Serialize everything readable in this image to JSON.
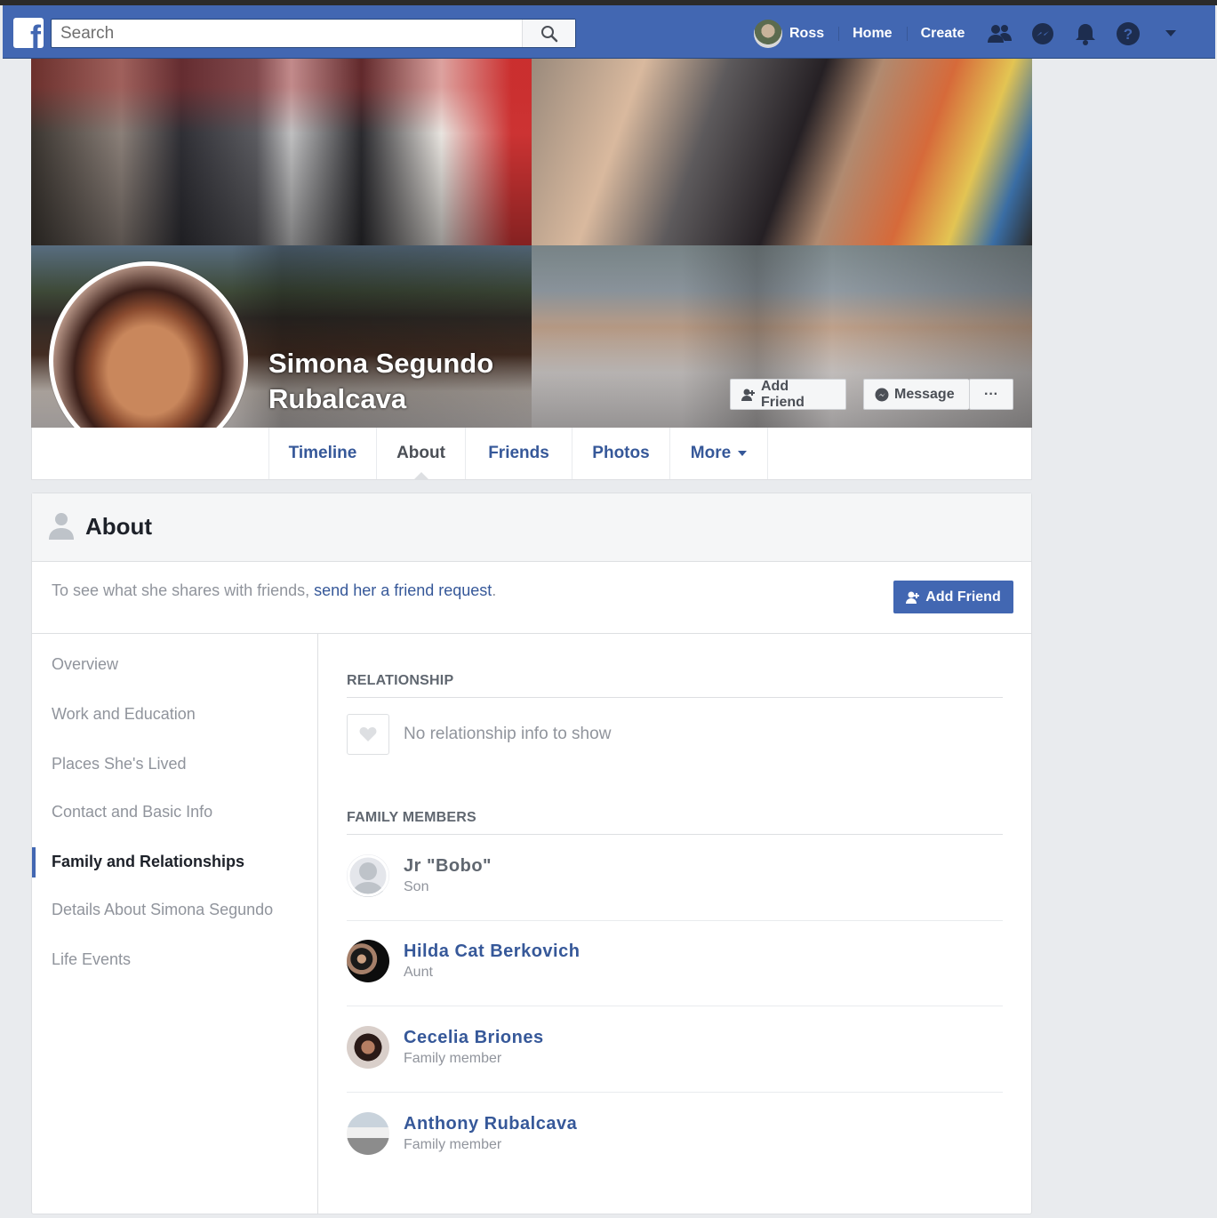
{
  "header": {
    "search_placeholder": "Search",
    "user_name": "Ross",
    "home_label": "Home",
    "create_label": "Create",
    "icons": [
      "friends-icon",
      "messenger-icon",
      "notifications-icon",
      "help-icon",
      "account-menu-icon"
    ]
  },
  "profile": {
    "name_line1": "Simona Segundo",
    "name_line2": "Rubalcava",
    "add_friend_label": "Add Friend",
    "message_label": "Message",
    "more_label": "···"
  },
  "tabs": [
    {
      "label": "Timeline"
    },
    {
      "label": "About"
    },
    {
      "label": "Friends"
    },
    {
      "label": "Photos"
    },
    {
      "label": "More"
    }
  ],
  "about": {
    "title": "About",
    "notice_prefix": "To see what she shares with friends, ",
    "notice_link": "send her a friend request",
    "notice_suffix": ".",
    "add_friend_label": "Add Friend",
    "nav": [
      {
        "label": "Overview"
      },
      {
        "label": "Work and Education"
      },
      {
        "label": "Places She's Lived"
      },
      {
        "label": "Contact and Basic Info"
      },
      {
        "label": "Family and Relationships"
      },
      {
        "label": "Details About Simona Segundo"
      },
      {
        "label": "Life Events"
      }
    ],
    "active_nav": "Family and Relationships",
    "relationship_title": "RELATIONSHIP",
    "relationship_empty": "No relationship info to show",
    "family_title": "FAMILY MEMBERS",
    "family": [
      {
        "name": "Jr \"Bobo\"",
        "relation": "Son"
      },
      {
        "name": "Hilda Cat Berkovich",
        "relation": "Aunt"
      },
      {
        "name": "Cecelia Briones",
        "relation": "Family member"
      },
      {
        "name": "Anthony Rubalcava",
        "relation": "Family member"
      }
    ]
  },
  "colors": {
    "brand_blue": "#4267b2",
    "link_blue": "#365899",
    "page_bg": "#e9ebee"
  }
}
